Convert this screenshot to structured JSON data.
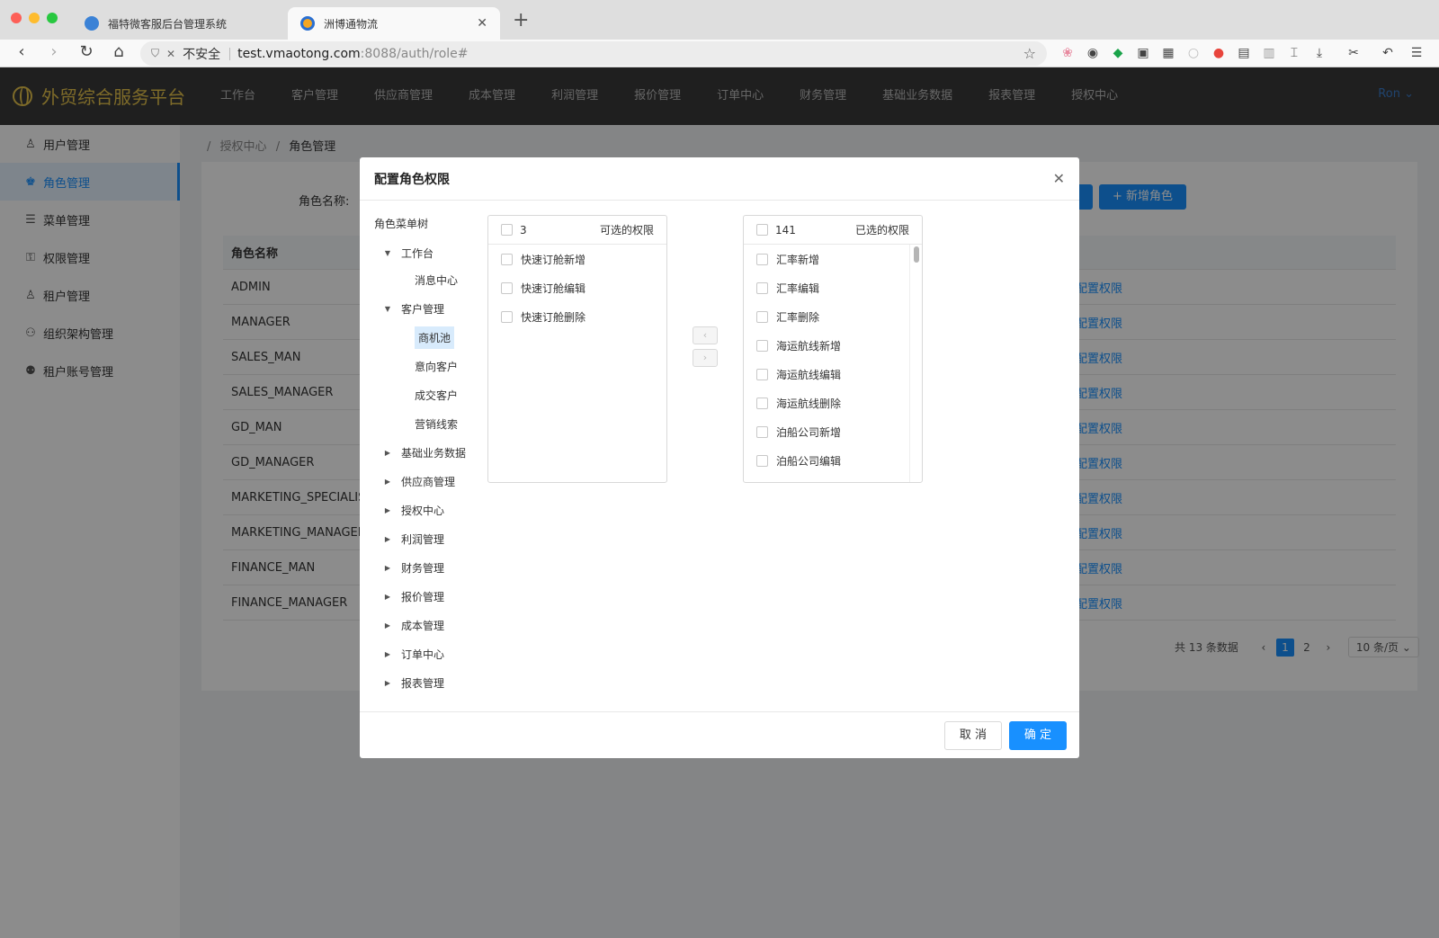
{
  "browser": {
    "tabs": [
      {
        "title": "福特微客服后台管理系统",
        "active": false,
        "favicon_color": "#3b82d6"
      },
      {
        "title": "洲博通物流",
        "active": true,
        "favicon_color": "#f5a623"
      }
    ],
    "url": {
      "security_label": "不安全",
      "host": "test.vmaotong.com",
      "path": ":8088/auth/role#"
    }
  },
  "app": {
    "title": "外贸综合服务平台",
    "topnav": [
      "工作台",
      "客户管理",
      "供应商管理",
      "成本管理",
      "利润管理",
      "报价管理",
      "订单中心",
      "财务管理",
      "基础业务数据",
      "报表管理",
      "授权中心"
    ],
    "user": "Ron",
    "accent_color": "#1890ff",
    "header_color": "#3a3a3a"
  },
  "sidebar": {
    "items": [
      {
        "label": "用户管理",
        "icon": "user-icon"
      },
      {
        "label": "角色管理",
        "icon": "role-icon",
        "active": true
      },
      {
        "label": "菜单管理",
        "icon": "menu-icon"
      },
      {
        "label": "权限管理",
        "icon": "lock-icon"
      },
      {
        "label": "租户管理",
        "icon": "tenant-icon"
      },
      {
        "label": "组织架构管理",
        "icon": "org-icon"
      },
      {
        "label": "租户账号管理",
        "icon": "account-icon"
      }
    ]
  },
  "breadcrumb": {
    "parent": "授权中心",
    "current": "角色管理"
  },
  "search": {
    "label": "角色名称:"
  },
  "add_role": {
    "label": "+ 新增角色"
  },
  "table": {
    "header": "角色名称",
    "op_label": "配置权限",
    "rows": [
      "ADMIN",
      "MANAGER",
      "SALES_MAN",
      "SALES_MANAGER",
      "GD_MAN",
      "GD_MANAGER",
      "MARKETING_SPECIALIST",
      "MARKETING_MANAGER",
      "FINANCE_MAN",
      "FINANCE_MANAGER"
    ]
  },
  "pagination": {
    "total": "共 13 条数据",
    "pages": [
      "1",
      "2"
    ],
    "current": "1",
    "page_size": "10 条/页"
  },
  "modal": {
    "title": "配置角色权限",
    "tree": {
      "title": "角色菜单树",
      "nodes": [
        {
          "label": "工作台",
          "expanded": true,
          "children": [
            "消息中心"
          ]
        },
        {
          "label": "客户管理",
          "expanded": true,
          "children": [
            "商机池",
            "意向客户",
            "成交客户",
            "营销线索"
          ],
          "selected": "商机池"
        },
        {
          "label": "基础业务数据"
        },
        {
          "label": "供应商管理"
        },
        {
          "label": "授权中心"
        },
        {
          "label": "利润管理"
        },
        {
          "label": "财务管理"
        },
        {
          "label": "报价管理"
        },
        {
          "label": "成本管理"
        },
        {
          "label": "订单中心"
        },
        {
          "label": "报表管理"
        }
      ]
    },
    "available": {
      "count": "3",
      "title": "可选的权限",
      "items": [
        "快速订舱新增",
        "快速订舱编辑",
        "快速订舱删除"
      ]
    },
    "selected": {
      "count": "141",
      "title": "已选的权限",
      "items": [
        "汇率新增",
        "汇率编辑",
        "汇率删除",
        "海运航线新增",
        "海运航线编辑",
        "海运航线删除",
        "泊船公司新增",
        "泊船公司编辑"
      ]
    },
    "cancel_label": "取 消",
    "ok_label": "确 定"
  }
}
